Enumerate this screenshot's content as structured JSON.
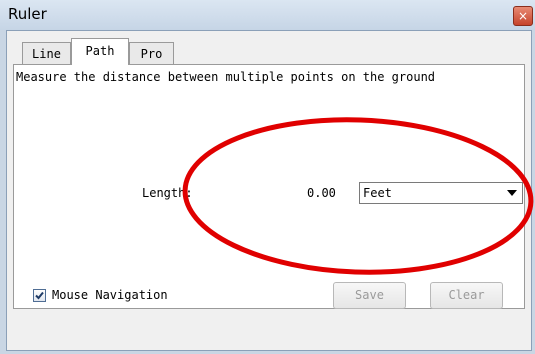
{
  "window": {
    "title": "Ruler",
    "close_glyph": "×"
  },
  "tabs": [
    {
      "label": "Line",
      "active": false
    },
    {
      "label": "Path",
      "active": true
    },
    {
      "label": "Pro",
      "active": false
    }
  ],
  "panel": {
    "description": "Measure the distance between multiple points on the ground",
    "length_label": "Length:",
    "length_value": "0.00",
    "unit_selected": "Feet"
  },
  "footer": {
    "mouse_navigation_label": "Mouse Navigation",
    "mouse_navigation_checked": true,
    "save_label": "Save",
    "clear_label": "Clear"
  },
  "colors": {
    "annotation_ellipse": "#e00000",
    "close_button": "#c6432b"
  }
}
